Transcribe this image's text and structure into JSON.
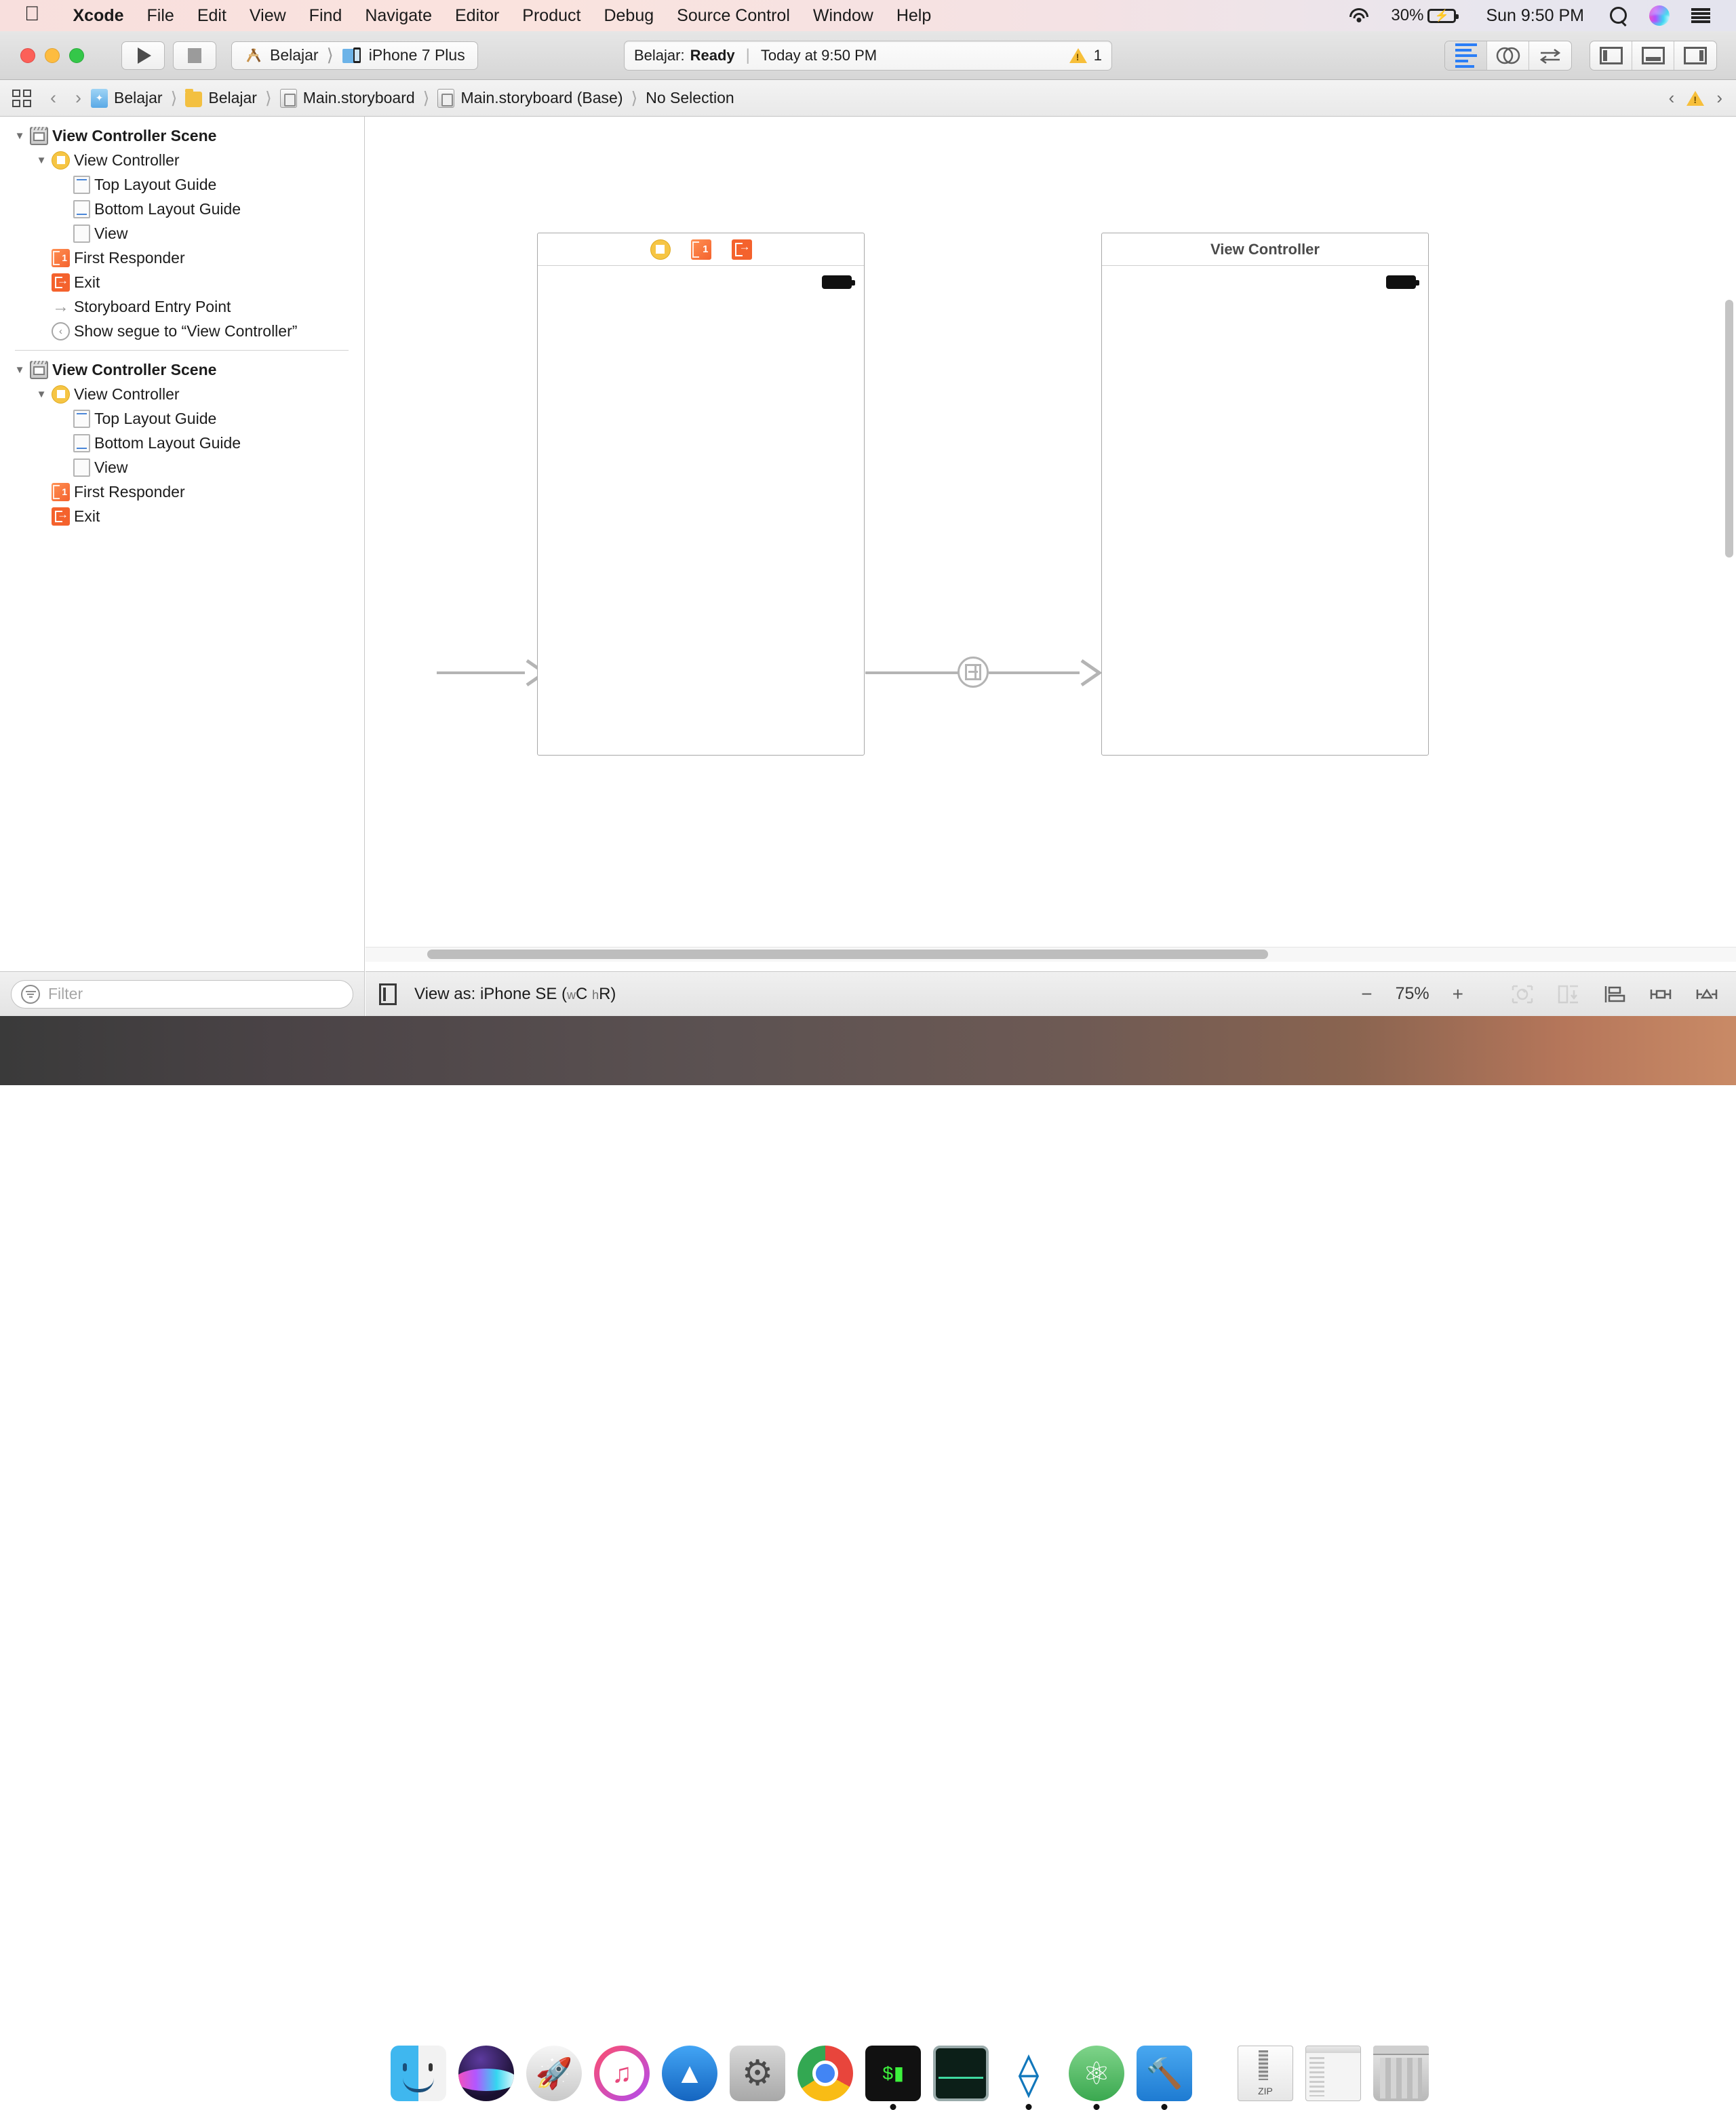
{
  "menubar": {
    "apple_icon": "apple-logo-icon",
    "items": [
      {
        "label": "Xcode",
        "bold": true
      },
      {
        "label": "File",
        "bold": false
      },
      {
        "label": "Edit",
        "bold": false
      },
      {
        "label": "View",
        "bold": false
      },
      {
        "label": "Find",
        "bold": false
      },
      {
        "label": "Navigate",
        "bold": false
      },
      {
        "label": "Editor",
        "bold": false
      },
      {
        "label": "Product",
        "bold": false
      },
      {
        "label": "Debug",
        "bold": false
      },
      {
        "label": "Source Control",
        "bold": false
      },
      {
        "label": "Window",
        "bold": false
      },
      {
        "label": "Help",
        "bold": false
      }
    ],
    "battery_percent": "30%",
    "clock": "Sun 9:50 PM",
    "icons": [
      "wifi-icon",
      "battery-charging-icon",
      "search-icon",
      "siri-icon",
      "notification-center-icon"
    ]
  },
  "toolbar": {
    "run_button": "run-button",
    "stop_button": "stop-button",
    "scheme_project": "Belajar",
    "scheme_device": "iPhone 7 Plus",
    "status": {
      "project": "Belajar:",
      "state": "Ready",
      "time": "Today at 9:50 PM",
      "warning_count": "1"
    },
    "editor_modes": [
      "standard-editor-icon",
      "assistant-editor-icon",
      "version-editor-icon"
    ],
    "view_toggles": [
      "navigator-toggle-icon",
      "debug-area-toggle-icon",
      "utilities-toggle-icon"
    ]
  },
  "jumpbar": {
    "grid_icon": "related-items-icon",
    "back": "‹",
    "forward": "›",
    "crumbs": [
      {
        "label": "Belajar",
        "icon": "xcode-project-icon"
      },
      {
        "label": "Belajar",
        "icon": "folder-icon"
      },
      {
        "label": "Main.storyboard",
        "icon": "storyboard-file-icon"
      },
      {
        "label": "Main.storyboard (Base)",
        "icon": "storyboard-file-icon"
      },
      {
        "label": "No Selection",
        "icon": "none"
      }
    ],
    "issue_prev": "‹",
    "issue_next": "›",
    "issue_icon": "warning-triangle-icon"
  },
  "navigator": {
    "groups": [
      {
        "scene": "View Controller Scene",
        "controller": "View Controller",
        "children": [
          {
            "label": "Top Layout Guide",
            "icon": "top-layout-guide-icon",
            "indent": 3
          },
          {
            "label": "Bottom Layout Guide",
            "icon": "bottom-layout-guide-icon",
            "indent": 3
          },
          {
            "label": "View",
            "icon": "view-icon",
            "indent": 3
          }
        ],
        "siblings": [
          {
            "label": "First Responder",
            "icon": "first-responder-icon"
          },
          {
            "label": "Exit",
            "icon": "exit-icon"
          },
          {
            "label": "Storyboard Entry Point",
            "icon": "storyboard-entry-point-icon"
          },
          {
            "label": "Show segue to “View Controller”",
            "icon": "segue-icon"
          }
        ]
      },
      {
        "scene": "View Controller Scene",
        "controller": "View Controller",
        "children": [
          {
            "label": "Top Layout Guide",
            "icon": "top-layout-guide-icon",
            "indent": 3
          },
          {
            "label": "Bottom Layout Guide",
            "icon": "bottom-layout-guide-icon",
            "indent": 3
          },
          {
            "label": "View",
            "icon": "view-icon",
            "indent": 3
          }
        ],
        "siblings": [
          {
            "label": "First Responder",
            "icon": "first-responder-icon"
          },
          {
            "label": "Exit",
            "icon": "exit-icon"
          }
        ]
      }
    ],
    "filter_placeholder": "Filter"
  },
  "canvas": {
    "scene_one": {
      "dock_icons": [
        "view-controller-dock-icon",
        "first-responder-dock-icon",
        "exit-dock-icon"
      ],
      "title": ""
    },
    "scene_two": {
      "title": "View Controller"
    },
    "segue_badge": "show-segue-badge-icon"
  },
  "canvasbar": {
    "view_as_icon": "device-preview-icon",
    "view_as_prefix": "View as:",
    "device": "iPhone SE",
    "size_class_w": "w",
    "size_class_wval": "C",
    "size_class_h": "h",
    "size_class_hval": "R",
    "zoom_out": "−",
    "zoom_level": "75%",
    "zoom_in": "+",
    "autolayout_icons": [
      "update-frames-icon",
      "embed-in-icon",
      "align-icon",
      "add-constraints-icon",
      "resolve-issues-icon"
    ]
  },
  "dock": {
    "items": [
      {
        "name": "finder",
        "label": "Finder",
        "running": true
      },
      {
        "name": "siri",
        "label": "Siri",
        "running": false
      },
      {
        "name": "launchpad",
        "label": "Launchpad",
        "running": false
      },
      {
        "name": "itunes",
        "label": "iTunes",
        "running": false
      },
      {
        "name": "appstore",
        "label": "App Store",
        "running": false
      },
      {
        "name": "system-preferences",
        "label": "System Preferences",
        "running": false
      },
      {
        "name": "chrome",
        "label": "Google Chrome",
        "running": true
      },
      {
        "name": "terminal",
        "label": "Terminal",
        "running": true
      },
      {
        "name": "activity-monitor",
        "label": "Activity Monitor",
        "running": true
      },
      {
        "name": "visual-studio",
        "label": "Visual Studio",
        "running": true
      },
      {
        "name": "atom",
        "label": "Atom",
        "running": true
      },
      {
        "name": "xcode",
        "label": "Xcode",
        "running": true
      }
    ],
    "stack_items": [
      {
        "name": "zip-file",
        "label": "ZIP"
      },
      {
        "name": "window-stack",
        "label": ""
      },
      {
        "name": "trash",
        "label": ""
      }
    ]
  },
  "colors": {
    "accent_blue": "#2b7ef6",
    "warning_yellow": "#f7bf3a",
    "exit_orange": "#f4622d",
    "vc_yellow": "#f6c544",
    "segue_gray": "#b4b4b4"
  }
}
